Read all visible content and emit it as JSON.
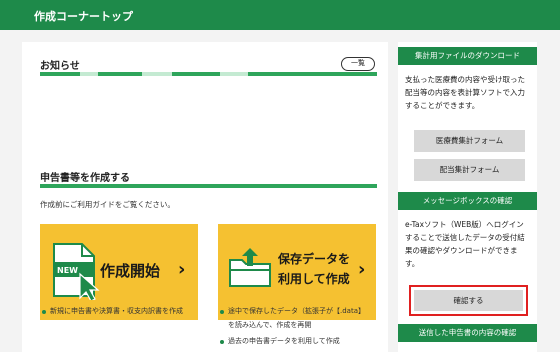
{
  "header": {
    "title": "作成コーナートップ"
  },
  "news": {
    "title": "お知らせ",
    "list_button": "一覧"
  },
  "create": {
    "title": "申告書等を作成する",
    "guide": "作成前にご利用ガイドをご覧ください。",
    "start": {
      "badge": "NEW",
      "label": "作成開始",
      "notes": [
        "新規に申告書や決算書・収支内訳書を作成"
      ]
    },
    "resume": {
      "line1": "保存データを",
      "line2": "利用して作成",
      "notes": [
        "途中で保存したデータ（拡張子が【.data】",
        "を読み込んで、作成を再開",
        "過去の申告書データを利用して作成"
      ]
    }
  },
  "sidebar": {
    "download": {
      "title": "集計用ファイルのダウンロード",
      "text": [
        "支払った医療費の内容や受け取った",
        "配当等の内容を表計算ソフトで入力",
        "することができます。"
      ],
      "medical_button": "医療費集計フォーム",
      "dividend_button": "配当集計フォーム"
    },
    "messagebox": {
      "title": "メッセージボックスの確認",
      "text": [
        "e-Taxソフト（WEB版）へログイン",
        "することで送信したデータの受付結",
        "果の確認やダウンロードができま",
        "す。"
      ],
      "confirm_button": "確認する"
    },
    "sent": {
      "title": "送信した申告書の内容の確認"
    }
  },
  "colors": {
    "brand_green": "#1e8a4a",
    "accent_yellow": "#f5c131",
    "highlight_red": "#e02020"
  }
}
